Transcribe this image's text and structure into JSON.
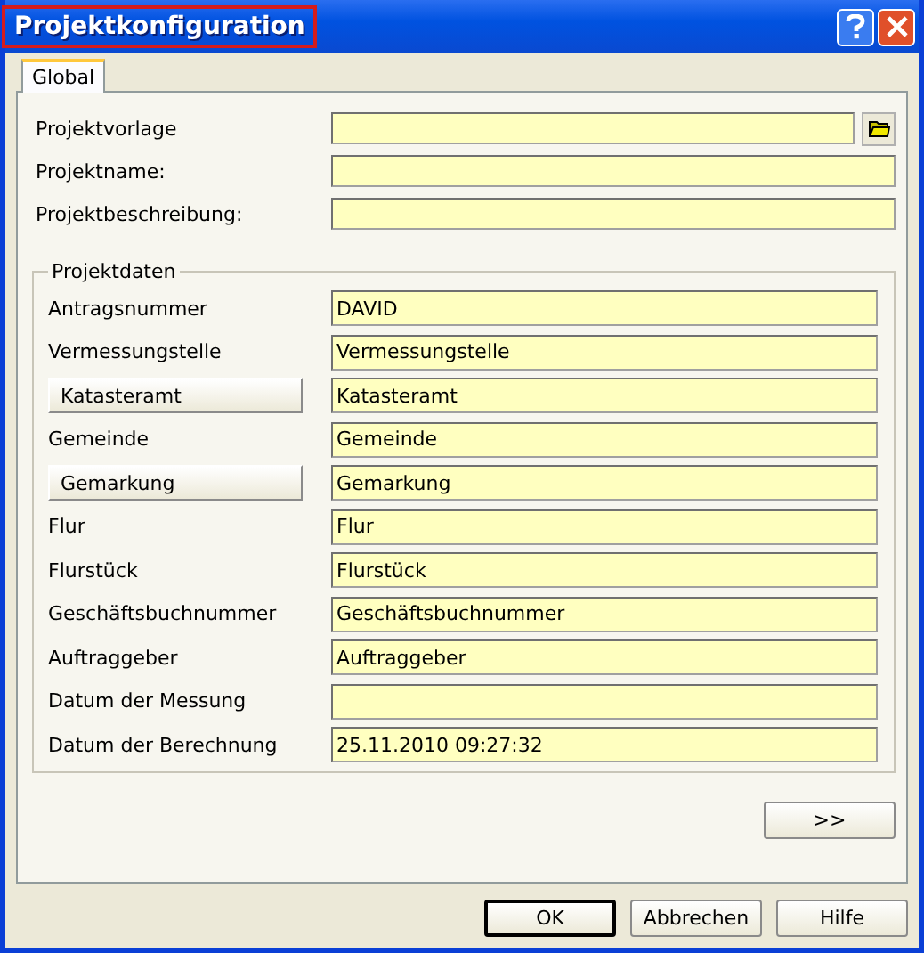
{
  "window": {
    "title": "Projektkonfiguration"
  },
  "tabs": [
    {
      "label": "Global",
      "selected": true
    }
  ],
  "project_fields": [
    {
      "label": "Projektvorlage",
      "browse": true
    },
    {
      "label": "Projektname:",
      "browse": false
    },
    {
      "label": "Projektbeschreibung:",
      "browse": false
    }
  ],
  "group": {
    "title": "Projektdaten",
    "rows": [
      {
        "kind": "label",
        "label": "Antragsnummer",
        "value": "DAVID"
      },
      {
        "kind": "label",
        "label": "Vermessungstelle",
        "value": "Vermessungstelle"
      },
      {
        "kind": "button",
        "label": "Katasteramt",
        "value": "Katasteramt"
      },
      {
        "kind": "label",
        "label": "Gemeinde",
        "value": "Gemeinde"
      },
      {
        "kind": "button",
        "label": "Gemarkung",
        "value": "Gemarkung"
      },
      {
        "kind": "label",
        "label": "Flur",
        "value": "Flur"
      },
      {
        "kind": "label",
        "label": "Flurstück",
        "value": "Flurstück"
      },
      {
        "kind": "label",
        "label": "Geschäftsbuchnummer",
        "value": "Geschäftsbuchnummer"
      },
      {
        "kind": "label",
        "label": "Auftraggeber",
        "value": "Auftraggeber"
      },
      {
        "kind": "label",
        "label": "Datum der Messung"
      },
      {
        "kind": "label",
        "label": "Datum der Berechnung",
        "value": "25.11.2010 09:27:32"
      }
    ]
  },
  "more_button": ">>",
  "buttons": [
    {
      "label": "OK",
      "default": true
    },
    {
      "label": "Abbrechen",
      "default": false
    },
    {
      "label": "Hilfe",
      "default": false
    }
  ]
}
